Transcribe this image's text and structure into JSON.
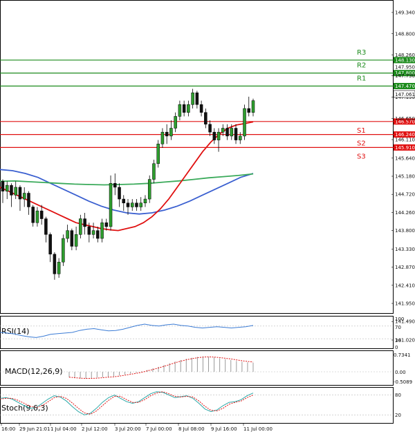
{
  "chart_data": {
    "type": "candlestick",
    "price_axis": {
      "ticks": [
        149.34,
        148.8,
        148.26,
        147.73,
        147.19,
        146.65,
        146.11,
        145.64,
        145.18,
        144.72,
        144.26,
        143.8,
        143.33,
        142.87,
        142.41,
        141.95,
        141.49,
        141.02
      ],
      "ylim": [
        141.02,
        149.55
      ]
    },
    "current_price": "147.061",
    "levels": [
      {
        "name": "R3",
        "value": 148.13,
        "label": "148.130",
        "color": "#1a8a1a"
      },
      {
        "name": "R2",
        "value": 147.8,
        "label": "147.800",
        "color": "#1a8a1a"
      },
      {
        "name": "R1",
        "value": 147.47,
        "label": "147.470",
        "color": "#1a8a1a"
      },
      {
        "name": "S1",
        "value": 146.57,
        "label": "146.570",
        "color": "#e01010"
      },
      {
        "name": "S2",
        "value": 146.24,
        "label": "146.240",
        "color": "#e01010"
      },
      {
        "name": "S3",
        "value": 145.91,
        "label": "145.910",
        "color": "#e01010"
      }
    ],
    "extra_tick": "147.950",
    "x_labels": [
      "16:00",
      "29 Jun 21:01",
      "1 Jul 04:00",
      "2 Jul 12:00",
      "3 Jul 20:00",
      "7 Jul 00:00",
      "8 Jul 08:00",
      "9 Jul 16:00",
      "11 Jul 00:00"
    ],
    "candles": [
      [
        145.05,
        144.8,
        145.1,
        144.5
      ],
      [
        144.8,
        144.95,
        145.05,
        144.6
      ],
      [
        144.95,
        144.7,
        145.0,
        144.4
      ],
      [
        144.7,
        144.9,
        145.05,
        144.6
      ],
      [
        144.9,
        144.6,
        144.95,
        144.3
      ],
      [
        144.6,
        144.75,
        144.9,
        144.4
      ],
      [
        144.75,
        144.4,
        144.8,
        144.2
      ],
      [
        144.4,
        144.0,
        144.45,
        143.9
      ],
      [
        144.0,
        144.3,
        144.4,
        143.9
      ],
      [
        144.3,
        144.1,
        144.45,
        143.95
      ],
      [
        144.1,
        143.7,
        144.15,
        143.5
      ],
      [
        143.7,
        143.2,
        143.75,
        143.0
      ],
      [
        143.2,
        142.7,
        143.25,
        142.55
      ],
      [
        142.7,
        143.0,
        143.1,
        142.6
      ],
      [
        143.0,
        143.6,
        143.7,
        142.9
      ],
      [
        143.6,
        143.8,
        143.95,
        143.5
      ],
      [
        143.8,
        143.4,
        143.85,
        143.3
      ],
      [
        143.4,
        143.7,
        143.9,
        143.3
      ],
      [
        143.7,
        144.1,
        144.2,
        143.6
      ],
      [
        144.1,
        143.9,
        144.25,
        143.7
      ],
      [
        143.9,
        143.7,
        144.0,
        143.5
      ],
      [
        143.7,
        143.8,
        144.0,
        143.6
      ],
      [
        143.8,
        143.6,
        143.9,
        143.5
      ],
      [
        143.6,
        144.0,
        144.1,
        143.5
      ],
      [
        144.0,
        143.9,
        144.1,
        143.8
      ],
      [
        143.9,
        145.0,
        145.2,
        143.8
      ],
      [
        145.0,
        144.9,
        145.25,
        144.7
      ],
      [
        144.9,
        144.6,
        145.0,
        144.4
      ],
      [
        144.6,
        144.5,
        144.7,
        144.3
      ],
      [
        144.5,
        144.4,
        144.6,
        144.2
      ],
      [
        144.4,
        144.5,
        144.6,
        144.3
      ],
      [
        144.5,
        144.4,
        144.6,
        144.3
      ],
      [
        144.4,
        144.5,
        144.65,
        144.3
      ],
      [
        144.5,
        144.6,
        144.7,
        144.4
      ],
      [
        144.6,
        145.1,
        145.2,
        144.5
      ],
      [
        145.1,
        145.5,
        145.6,
        145.0
      ],
      [
        145.5,
        146.0,
        146.1,
        145.4
      ],
      [
        146.0,
        146.3,
        146.4,
        145.9
      ],
      [
        146.3,
        146.2,
        146.5,
        146.0
      ],
      [
        146.2,
        146.4,
        146.6,
        146.1
      ],
      [
        146.4,
        146.7,
        146.8,
        146.3
      ],
      [
        146.7,
        147.0,
        147.1,
        146.6
      ],
      [
        147.0,
        146.8,
        147.1,
        146.7
      ],
      [
        146.8,
        147.0,
        147.1,
        146.7
      ],
      [
        147.0,
        147.3,
        147.4,
        146.9
      ],
      [
        147.3,
        147.0,
        147.35,
        146.9
      ],
      [
        147.0,
        146.8,
        147.1,
        146.7
      ],
      [
        146.8,
        146.5,
        146.9,
        146.4
      ],
      [
        146.5,
        146.3,
        146.6,
        146.2
      ],
      [
        146.3,
        146.1,
        146.4,
        146.0
      ],
      [
        146.1,
        146.3,
        146.4,
        145.8
      ],
      [
        146.3,
        146.4,
        146.5,
        146.2
      ],
      [
        146.4,
        146.2,
        146.5,
        146.1
      ],
      [
        146.2,
        146.4,
        146.5,
        146.1
      ],
      [
        146.4,
        146.1,
        146.5,
        146.0
      ],
      [
        146.1,
        146.2,
        146.3,
        146.0
      ],
      [
        146.2,
        146.9,
        147.0,
        146.1
      ],
      [
        146.9,
        146.8,
        147.2,
        146.7
      ],
      [
        146.8,
        147.1,
        147.15,
        146.7
      ]
    ],
    "ma_red": [
      144.9,
      144.8,
      144.7,
      144.6,
      144.5,
      144.4,
      144.3,
      144.2,
      144.1,
      144.0,
      143.95,
      143.9,
      143.85,
      143.82,
      143.8,
      143.85,
      143.9,
      144.0,
      144.15,
      144.35,
      144.6,
      144.9,
      145.2,
      145.5,
      145.8,
      146.05,
      146.25,
      146.4,
      146.48,
      146.52,
      146.56
    ],
    "ma_green": [
      145.05,
      145.06,
      145.04,
      145.02,
      145.0,
      144.98,
      144.97,
      144.96,
      144.97,
      144.98,
      145.0,
      145.03,
      145.06,
      145.1,
      145.14,
      145.17,
      145.2,
      145.24
    ],
    "ma_blue": [
      145.35,
      145.32,
      145.25,
      145.15,
      145.0,
      144.85,
      144.7,
      144.55,
      144.42,
      144.32,
      144.25,
      144.22,
      144.25,
      144.32,
      144.42,
      144.55,
      144.7,
      144.85,
      145.0,
      145.15,
      145.25
    ],
    "rsi": {
      "label": "RSI(14)",
      "ticks": [
        100,
        70,
        30,
        0
      ],
      "values": [
        50,
        48,
        45,
        40,
        36,
        34,
        38,
        44,
        46,
        48,
        50,
        56,
        60,
        62,
        58,
        55,
        56,
        60,
        66,
        72,
        76,
        72,
        70,
        74,
        76,
        72,
        70,
        66,
        64,
        66,
        68,
        66,
        64,
        66,
        68,
        72
      ]
    },
    "macd": {
      "label": "MACD(12,26,9)",
      "ticks": [
        "0.7341",
        "0.00",
        "-0.5089"
      ],
      "hist": [
        -0.25,
        -0.28,
        -0.3,
        -0.3,
        -0.28,
        -0.26,
        -0.24,
        -0.22,
        -0.2,
        -0.16,
        -0.12,
        -0.08,
        -0.04,
        0.02,
        0.08,
        0.15,
        0.22,
        0.3,
        0.38,
        0.46,
        0.52,
        0.58,
        0.62,
        0.66,
        0.68,
        0.66,
        0.64,
        0.6,
        0.56,
        0.52,
        0.48,
        0.44,
        0.42,
        0.4
      ],
      "signal": [
        -0.24,
        -0.26,
        -0.28,
        -0.29,
        -0.29,
        -0.28,
        -0.26,
        -0.24,
        -0.22,
        -0.19,
        -0.15,
        -0.11,
        -0.07,
        -0.02,
        0.04,
        0.1,
        0.17,
        0.24,
        0.32,
        0.4,
        0.47,
        0.53,
        0.58,
        0.62,
        0.65,
        0.66,
        0.65,
        0.63,
        0.6,
        0.57,
        0.53,
        0.49,
        0.46,
        0.43
      ]
    },
    "stoch": {
      "label": "Stoch(9,6,3)",
      "ticks": [
        80,
        20
      ],
      "k": [
        70,
        72,
        68,
        58,
        48,
        40,
        42,
        55,
        68,
        78,
        74,
        62,
        45,
        30,
        20,
        25,
        40,
        58,
        72,
        80,
        70,
        60,
        55,
        60,
        72,
        84,
        90,
        88,
        80,
        72,
        75,
        78,
        70,
        55,
        38,
        30,
        35,
        48,
        58,
        60,
        66,
        78,
        86
      ],
      "d": [
        68,
        70,
        70,
        64,
        55,
        46,
        42,
        48,
        60,
        72,
        76,
        70,
        56,
        40,
        26,
        22,
        32,
        48,
        64,
        76,
        76,
        66,
        58,
        58,
        66,
        78,
        86,
        90,
        84,
        76,
        74,
        76,
        74,
        62,
        46,
        34,
        32,
        40,
        52,
        58,
        62,
        72,
        80
      ]
    }
  }
}
